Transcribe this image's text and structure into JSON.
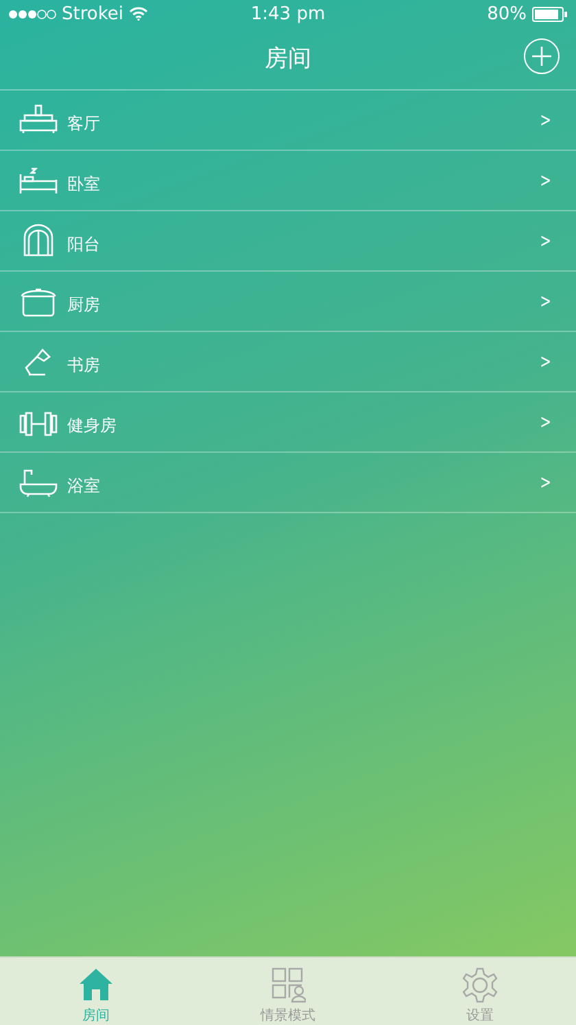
{
  "status_bar": {
    "carrier": "Strokei",
    "time": "1:43 pm",
    "battery": "80%"
  },
  "nav": {
    "title": "房间"
  },
  "rooms": [
    {
      "kind": "sofa",
      "name": "客厅",
      "chevron": ">"
    },
    {
      "kind": "bed",
      "name": "卧室",
      "chevron": ">"
    },
    {
      "kind": "window",
      "name": "阳台",
      "chevron": ">"
    },
    {
      "kind": "pot",
      "name": "厨房",
      "chevron": ">"
    },
    {
      "kind": "lamp",
      "name": "书房",
      "chevron": ">"
    },
    {
      "kind": "dumbbell",
      "name": "健身房",
      "chevron": ">"
    },
    {
      "kind": "bathtub",
      "name": "浴室",
      "chevron": ">"
    }
  ],
  "tabs": [
    {
      "kind": "house",
      "label": "房间",
      "selected": true
    },
    {
      "kind": "scenes",
      "label": "情景模式",
      "selected": false
    },
    {
      "kind": "gear",
      "label": "设置",
      "selected": false
    }
  ]
}
